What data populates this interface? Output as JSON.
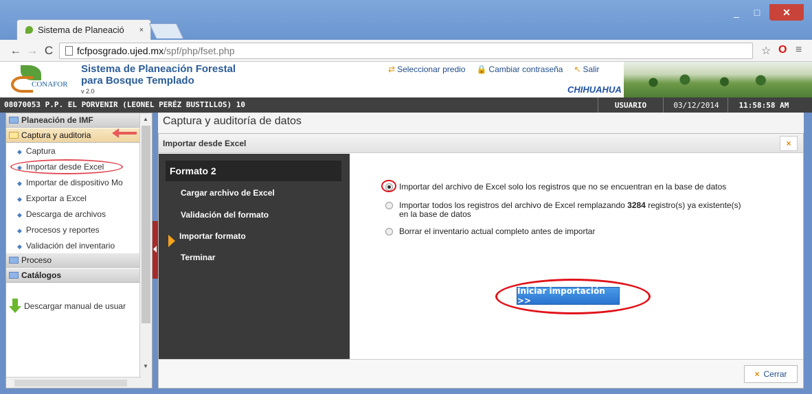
{
  "browser": {
    "tab_title": "Sistema de Planeació",
    "tab_close": "×",
    "url_host": "fcfposgrado.ujed.mx",
    "url_path": "/spf/php/fset.php",
    "back": "←",
    "forward": "→",
    "reload": "C",
    "star": "☆",
    "menu": "≡",
    "win_min": "_",
    "win_max": "□",
    "win_close": "✕"
  },
  "header": {
    "logo_text": "CONAFOR",
    "title_line1": "Sistema de Planeación Forestal",
    "title_line2": "para Bosque Templado",
    "version": "v 2.0",
    "link_predio": "Seleccionar predio",
    "link_password": "Cambiar contraseña",
    "link_exit": "Salir",
    "state": "CHIHUAHUA"
  },
  "statusbar": {
    "left": "08070053 P.P. EL PORVENIR (LEONEL PERÉZ BUSTILLOS) 10",
    "user": "USUARIO",
    "date": "03/12/2014",
    "time": "11:58:58 AM"
  },
  "sidebar": {
    "group1": "Planeación de IMF",
    "group2": "Captura y auditoria",
    "items": [
      "Captura",
      "Importar desde Excel",
      "Importar de dispositivo Mo",
      "Exportar a Excel",
      "Descarga de archivos",
      "Procesos y reportes",
      "Validación del inventario"
    ],
    "group3": "Proceso",
    "group4": "Catálogos",
    "manual": "Descargar manual de usuar"
  },
  "main": {
    "page_title": "Captura y auditoría de datos",
    "dialog_title": "Importar desde Excel",
    "dialog_close": "×",
    "steps_header": "Formato 2",
    "steps": [
      "Cargar archivo de Excel",
      "Validación del formato",
      "Importar formato",
      "Terminar"
    ],
    "current_step": 2,
    "option1": "Importar del archivo de Excel solo los registros que no se encuentran en la base de datos",
    "option2_a": "Importar todos los registros del archivo de Excel remplazando ",
    "option2_count": "3284",
    "option2_b": " registro(s) ya existente(s)",
    "option2_c": "en la base de datos",
    "option3": "Borrar el inventario actual completo antes de importar",
    "start_button": "Iniciar importación >>",
    "close_button": "Cerrar",
    "close_icon": "×"
  },
  "colors": {
    "accent_blue": "#2a73cf",
    "highlight_red": "#e1121a",
    "status_dark": "#404040",
    "step_marker": "#f6a31c"
  }
}
